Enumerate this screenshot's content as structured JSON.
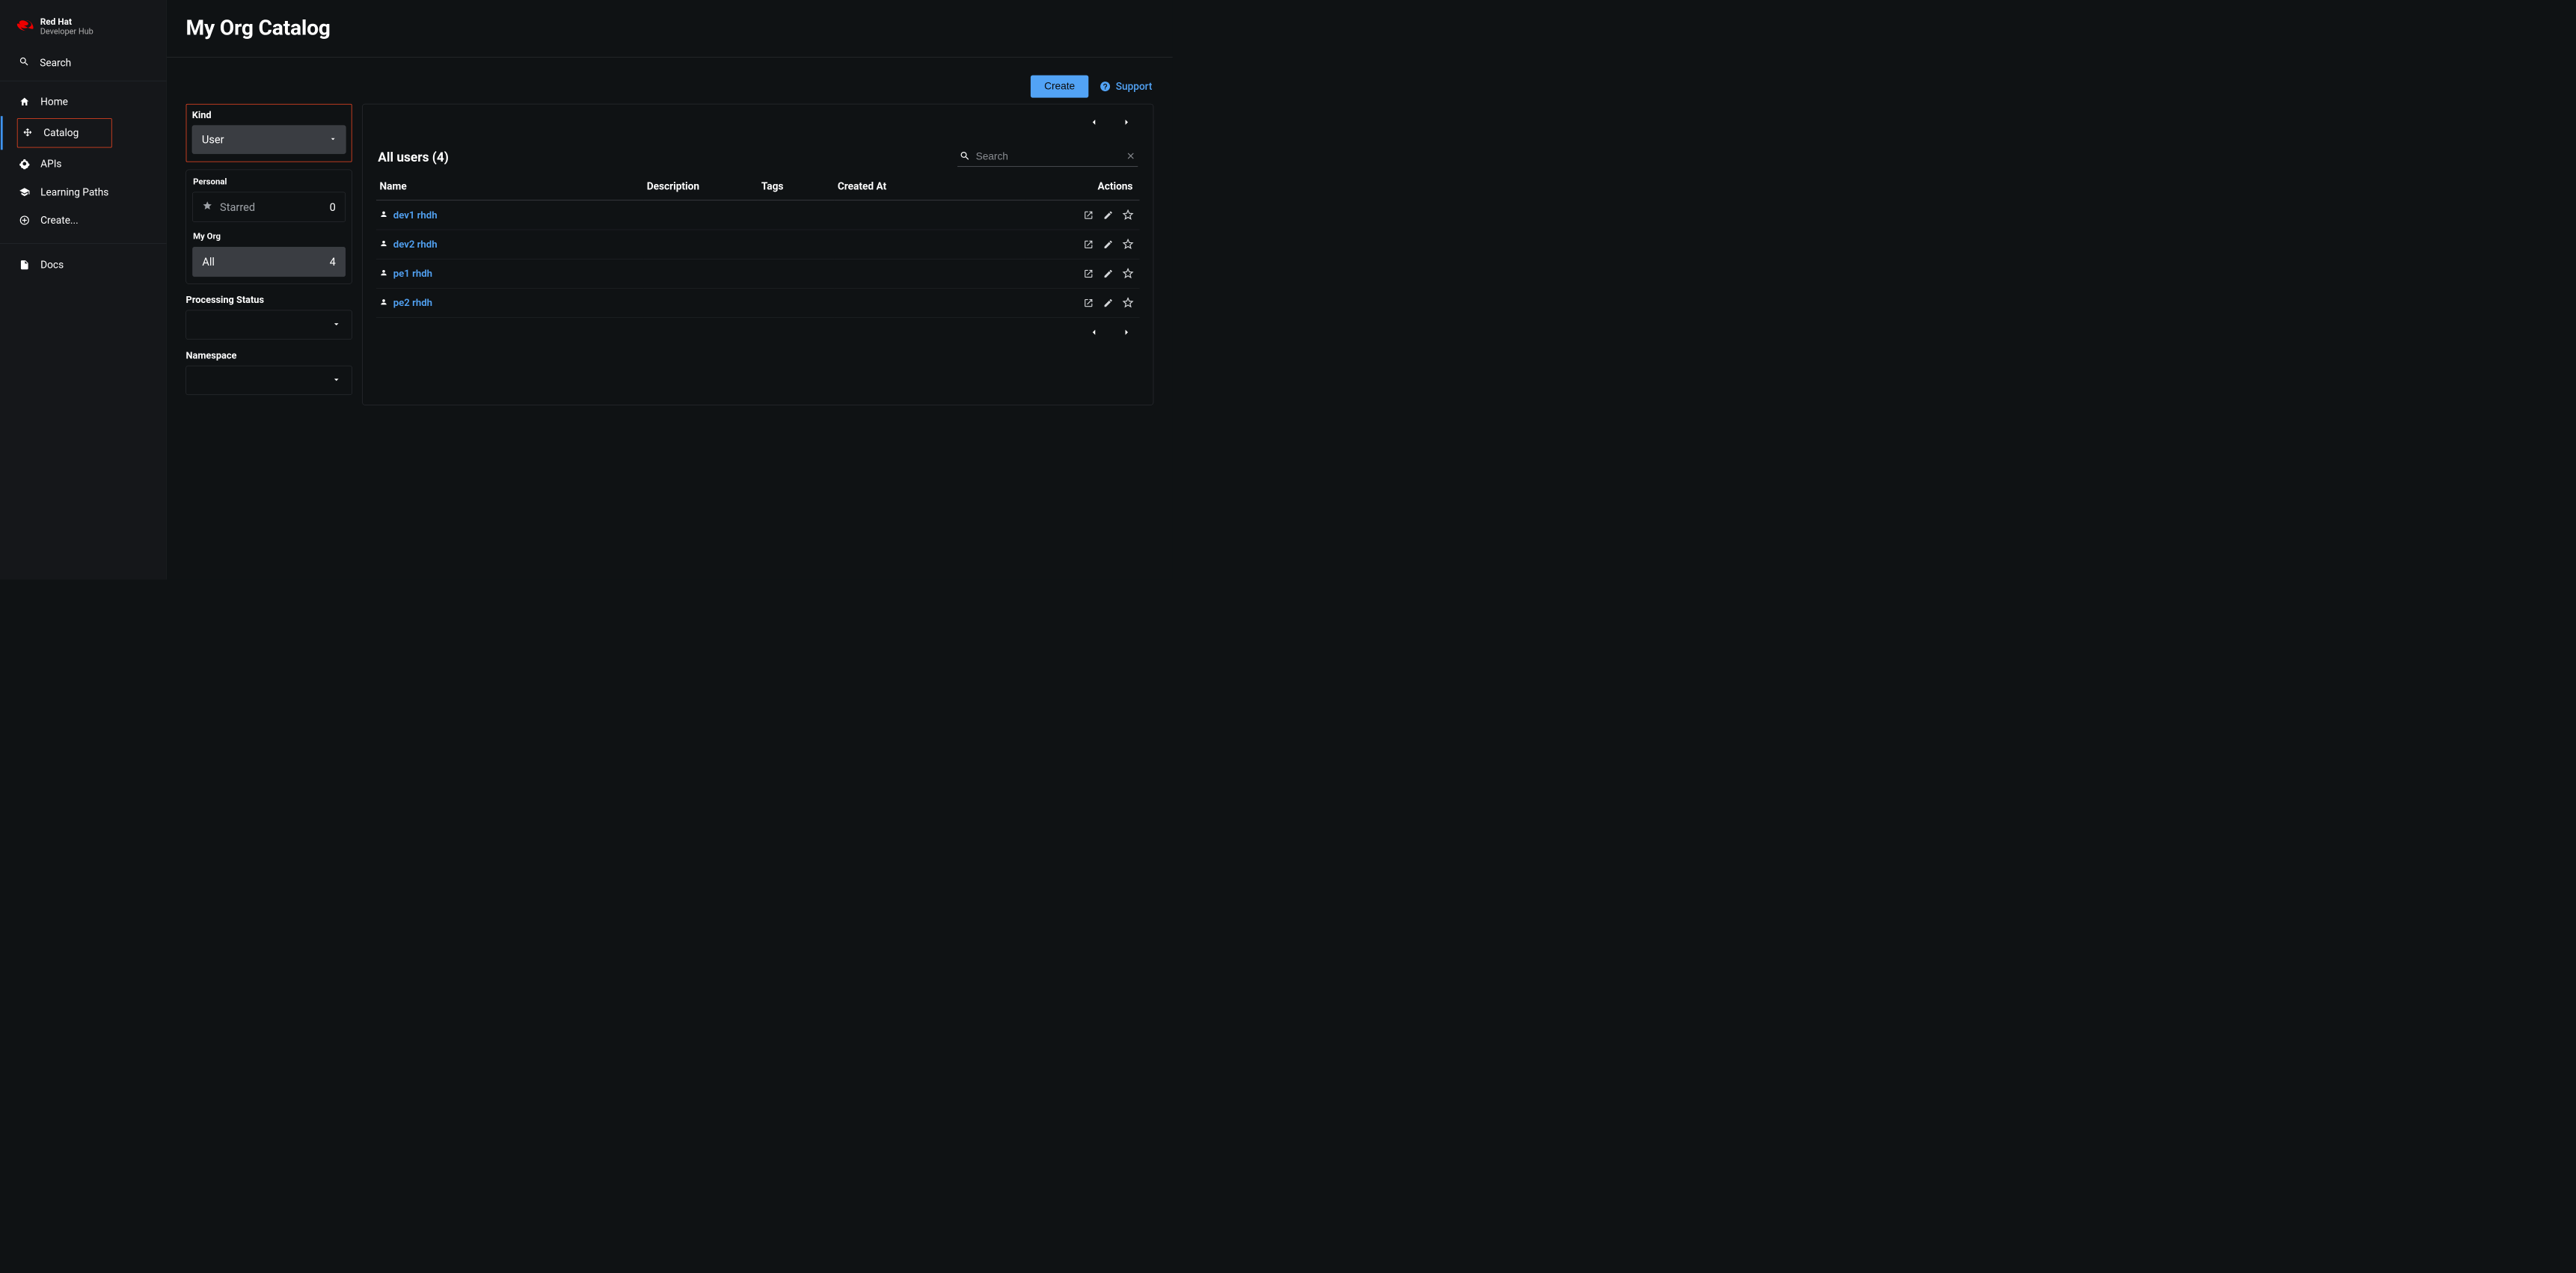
{
  "brand": {
    "main": "Red Hat",
    "sub": "Developer Hub"
  },
  "sidebar": {
    "search": "Search",
    "nav": [
      {
        "label": "Home",
        "icon": "home-icon"
      },
      {
        "label": "Catalog",
        "icon": "catalog-icon",
        "active": true
      },
      {
        "label": "APIs",
        "icon": "apis-icon"
      },
      {
        "label": "Learning Paths",
        "icon": "learning-icon"
      },
      {
        "label": "Create...",
        "icon": "create-icon"
      }
    ],
    "docs": {
      "label": "Docs",
      "icon": "docs-icon"
    }
  },
  "page": {
    "title": "My Org Catalog",
    "create_label": "Create",
    "support_label": "Support"
  },
  "filters": {
    "kind": {
      "label": "Kind",
      "value": "User"
    },
    "personal": {
      "header": "Personal",
      "starred_label": "Starred",
      "starred_count": "0"
    },
    "myorg": {
      "header": "My Org",
      "all_label": "All",
      "all_count": "4"
    },
    "processing": {
      "label": "Processing Status"
    },
    "namespace": {
      "label": "Namespace"
    }
  },
  "table": {
    "title": "All users (4)",
    "search_placeholder": "Search",
    "columns": {
      "name": "Name",
      "description": "Description",
      "tags": "Tags",
      "created_at": "Created At",
      "actions": "Actions"
    },
    "rows": [
      {
        "name": "dev1 rhdh"
      },
      {
        "name": "dev2 rhdh"
      },
      {
        "name": "pe1 rhdh"
      },
      {
        "name": "pe2 rhdh"
      }
    ]
  }
}
